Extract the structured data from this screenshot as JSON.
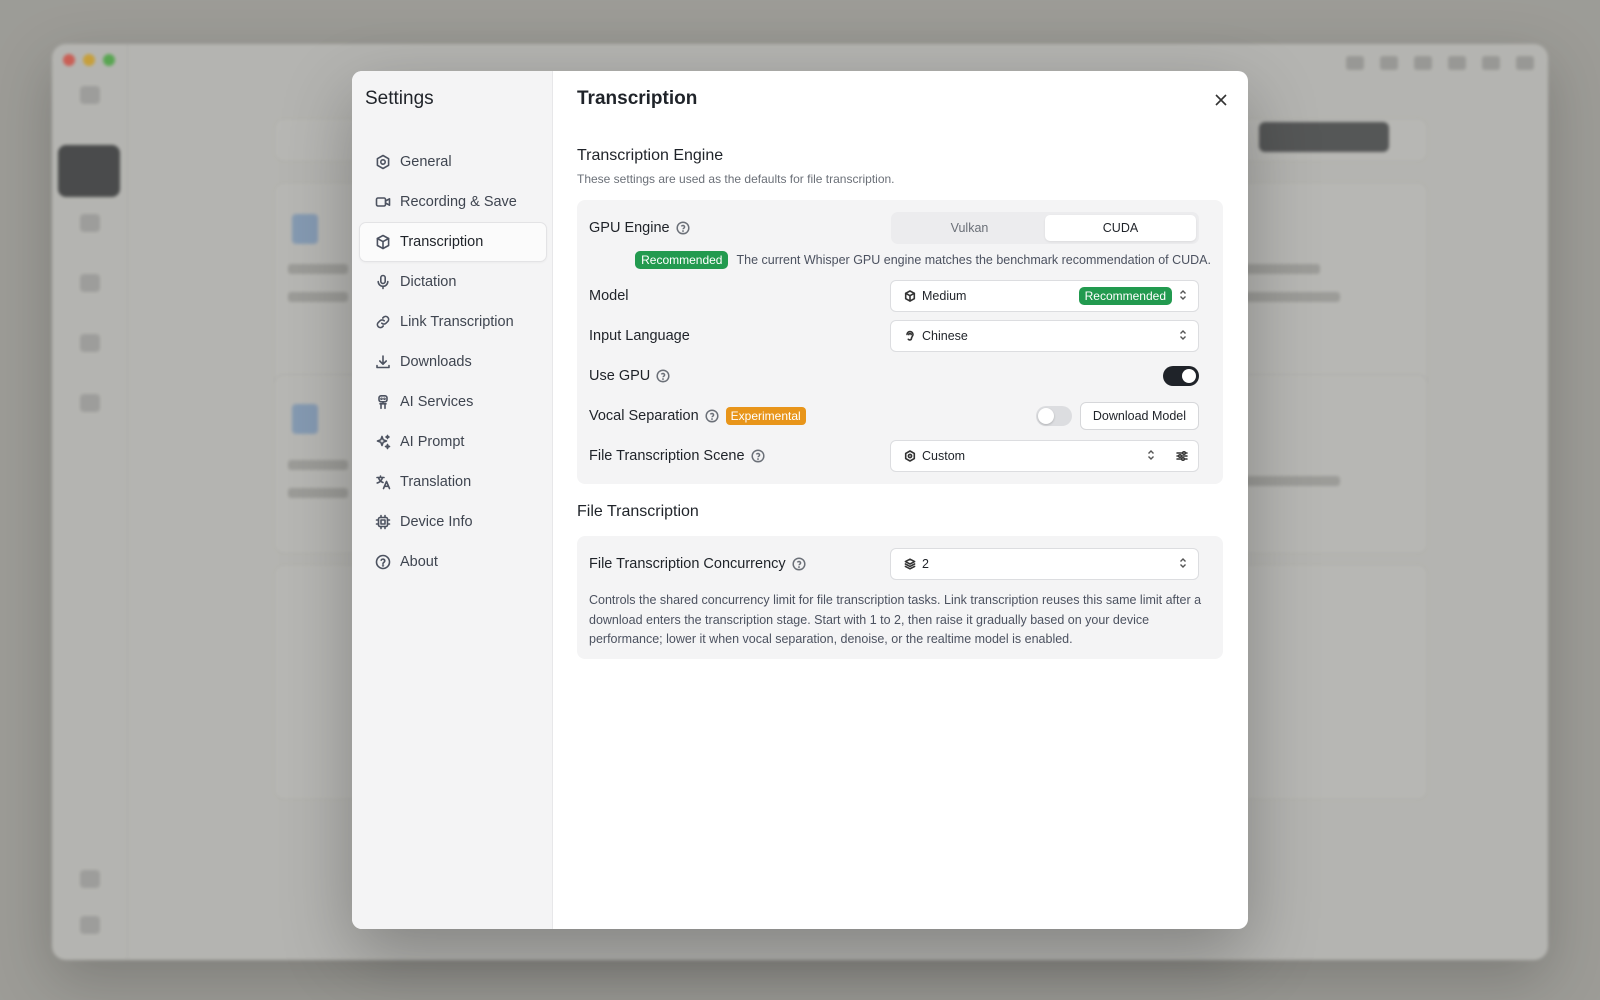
{
  "settings": {
    "title": "Settings",
    "nav": [
      {
        "label": "General",
        "icon": "settings-icon"
      },
      {
        "label": "Recording & Save",
        "icon": "video-icon"
      },
      {
        "label": "Transcription",
        "icon": "box-icon"
      },
      {
        "label": "Dictation",
        "icon": "mic-icon"
      },
      {
        "label": "Link Transcription",
        "icon": "link-icon"
      },
      {
        "label": "Downloads",
        "icon": "download-icon"
      },
      {
        "label": "AI Services",
        "icon": "bot-icon"
      },
      {
        "label": "AI Prompt",
        "icon": "sparkles-icon"
      },
      {
        "label": "Translation",
        "icon": "languages-icon"
      },
      {
        "label": "Device Info",
        "icon": "cpu-icon"
      },
      {
        "label": "About",
        "icon": "help-circle-icon"
      }
    ],
    "active_nav": "Transcription"
  },
  "page": {
    "title": "Transcription",
    "engine_section": {
      "title": "Transcription Engine",
      "description": "These settings are used as the defaults for file transcription.",
      "gpu_engine": {
        "label": "GPU Engine",
        "options": [
          "Vulkan",
          "CUDA"
        ],
        "selected": "CUDA",
        "badge": "Recommended",
        "note": "The current Whisper GPU engine matches the benchmark recommendation of CUDA."
      },
      "model": {
        "label": "Model",
        "value": "Medium",
        "badge": "Recommended"
      },
      "input_language": {
        "label": "Input Language",
        "value": "Chinese"
      },
      "use_gpu": {
        "label": "Use GPU",
        "enabled": true
      },
      "vocal_separation": {
        "label": "Vocal Separation",
        "badge": "Experimental",
        "enabled": false,
        "button": "Download Model"
      },
      "scene": {
        "label": "File Transcription Scene",
        "value": "Custom"
      }
    },
    "file_section": {
      "title": "File Transcription",
      "concurrency": {
        "label": "File Transcription Concurrency",
        "value": "2",
        "description": "Controls the shared concurrency limit for file transcription tasks. Link transcription reuses this same limit after a download enters the transcription stage. Start with 1 to 2, then raise it gradually based on your device performance; lower it when vocal separation, denoise, or the realtime model is enabled."
      }
    }
  },
  "colors": {
    "accent_dark": "#1f2329",
    "recommended_green": "#229a4f",
    "experimental_orange": "#e8951a"
  }
}
